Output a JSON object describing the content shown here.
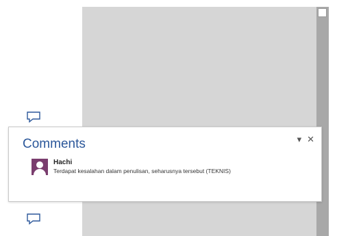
{
  "comments_pane": {
    "title": "Comments",
    "menu_glyph": "▾",
    "close_glyph": "✕",
    "comment": {
      "author": "Hachi",
      "text": "Terdapat kesalahan dalam penulisan, seharusnya tersebut (TEKNIS)"
    }
  },
  "colors": {
    "accent": "#2b579a",
    "avatar": "#7a3d6e",
    "canvas": "#d6d6d6",
    "scrollbar": "#a8a8a8"
  },
  "icons": {
    "comment_marker": "speech-bubble-icon",
    "avatar": "user-avatar-icon"
  }
}
